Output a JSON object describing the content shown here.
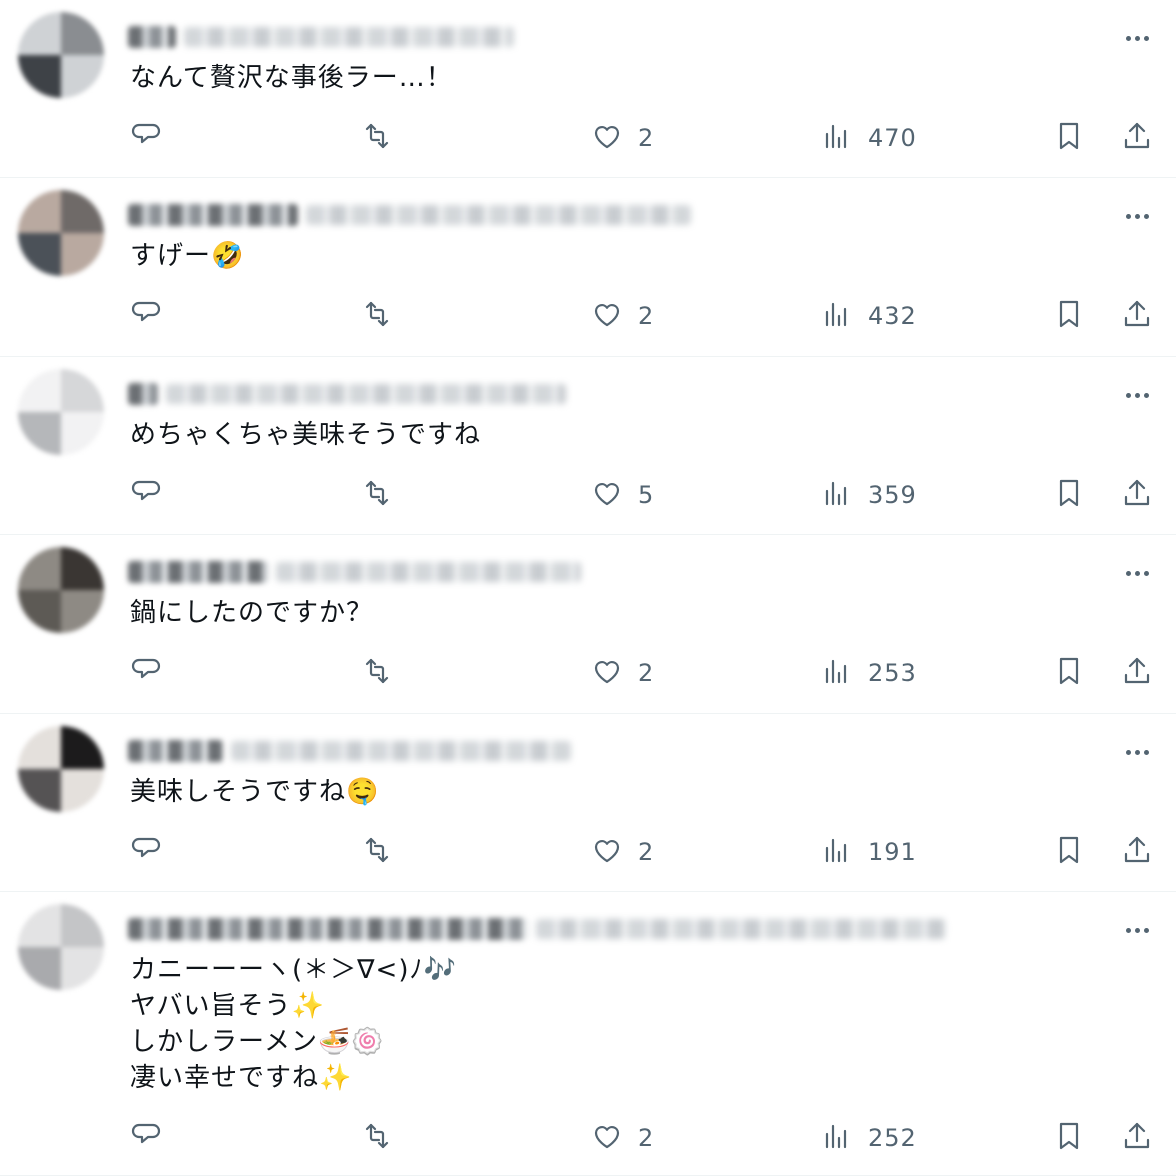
{
  "replies": [
    {
      "text": "なんて贅沢な事後ラー…！",
      "counts": {
        "likes": "2",
        "views": "470"
      },
      "avatar_colors": [
        "#8a8d91",
        "#cfd2d5",
        "#3e4247"
      ]
    },
    {
      "text": "すげー🤣",
      "counts": {
        "likes": "2",
        "views": "432"
      },
      "avatar_colors": [
        "#6f6a68",
        "#b9a9a0",
        "#4b5158"
      ]
    },
    {
      "text": "めちゃくちゃ美味そうですね",
      "counts": {
        "likes": "5",
        "views": "359"
      },
      "avatar_colors": [
        "#d6d7d9",
        "#f2f2f3",
        "#b5b7ba"
      ]
    },
    {
      "text": "鍋にしたのですか？",
      "counts": {
        "likes": "2",
        "views": "253"
      },
      "avatar_colors": [
        "#3a3633",
        "#8e8a84",
        "#5d5a55"
      ]
    },
    {
      "text": "美味しそうですね🤤",
      "counts": {
        "likes": "2",
        "views": "191"
      },
      "avatar_colors": [
        "#1c1b1c",
        "#e4e0dc",
        "#555354"
      ]
    },
    {
      "text": "カニーーーヽ(＊＞∇<)ﾉ🎶\nヤバい旨そう✨\nしかしラーメン🍜🍥\n凄い幸せですね✨",
      "counts": {
        "likes": "2",
        "views": "252"
      },
      "avatar_colors": [
        "#c4c5c7",
        "#e3e3e4",
        "#a9aaad"
      ]
    }
  ],
  "icons": {
    "reply": "reply-bubble-icon",
    "repost": "repost-icon",
    "like": "heart-icon",
    "views": "analytics-icon",
    "bookmark": "bookmark-icon",
    "share": "share-icon",
    "more": "more-dots-icon"
  },
  "colors": {
    "icon": "#536471",
    "divider": "#eff3f4",
    "text": "#0f1419"
  }
}
